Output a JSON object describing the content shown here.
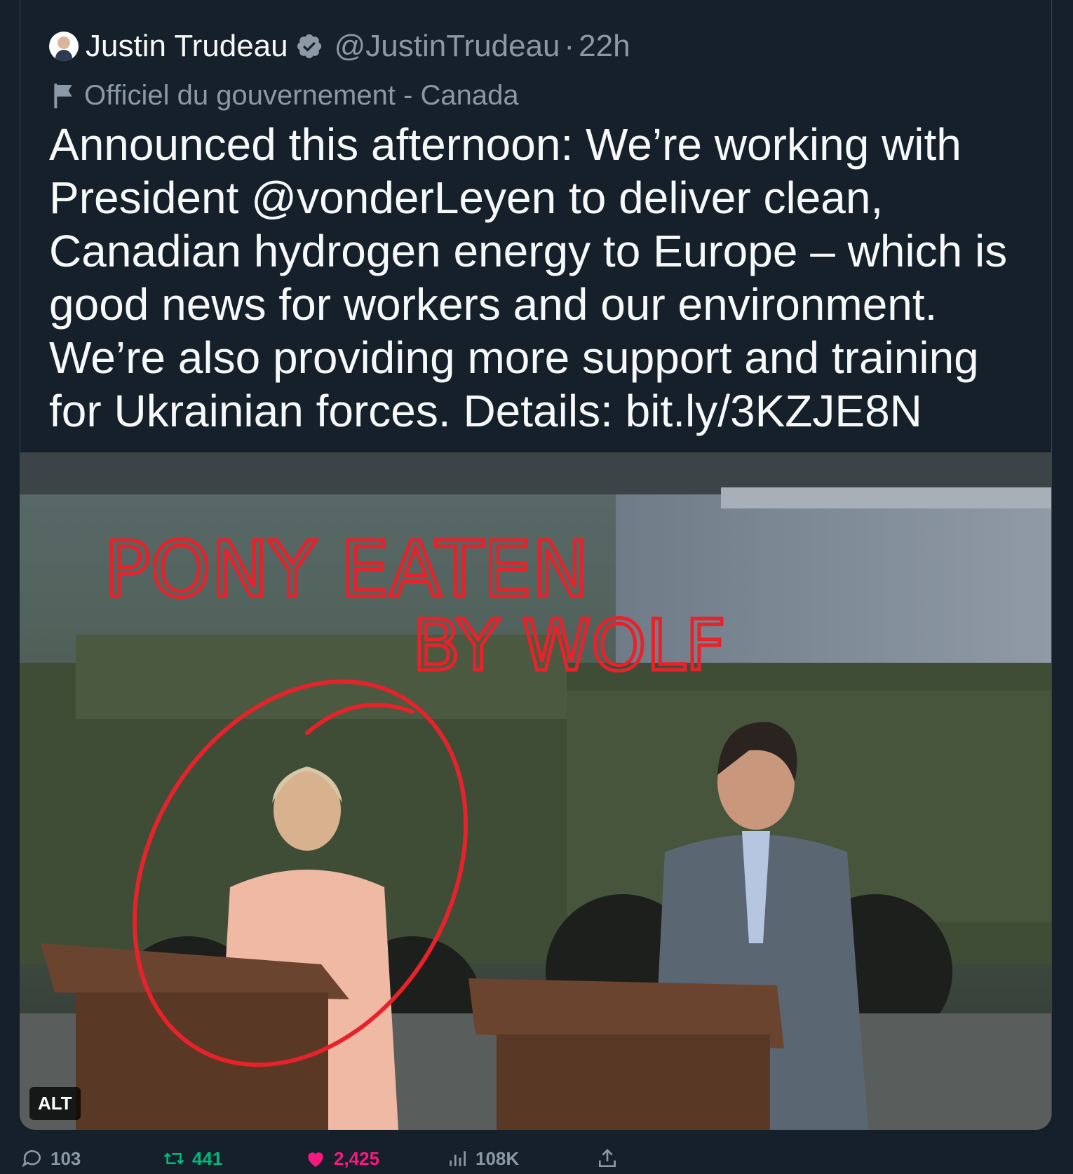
{
  "tweet": {
    "author_name": "Justin Trudeau",
    "handle": "@JustinTrudeau",
    "separator": "·",
    "time": "22h",
    "account_label": "Officiel du gouvernement - Canada",
    "text": "Announced this afternoon: We’re working with President @vonderLeyen to deliver clean, Canadian hydrogen energy to Europe – which is good news for workers and our environment. We’re also providing more support and training for Ukrainian forces. Details: bit.ly/3KZJE8N"
  },
  "media": {
    "handwritten_overlay": [
      "PONY EATEN",
      "BY WOLF"
    ],
    "alt_badge": "ALT"
  },
  "actions": {
    "replies": "103",
    "retweets": "441",
    "likes": "2,425",
    "views": "108K"
  },
  "colors": {
    "background": "#15202b",
    "verified": "#8b98a5",
    "retweet": "#00ba7c",
    "like": "#f91880",
    "annotation": "#e8222a"
  }
}
